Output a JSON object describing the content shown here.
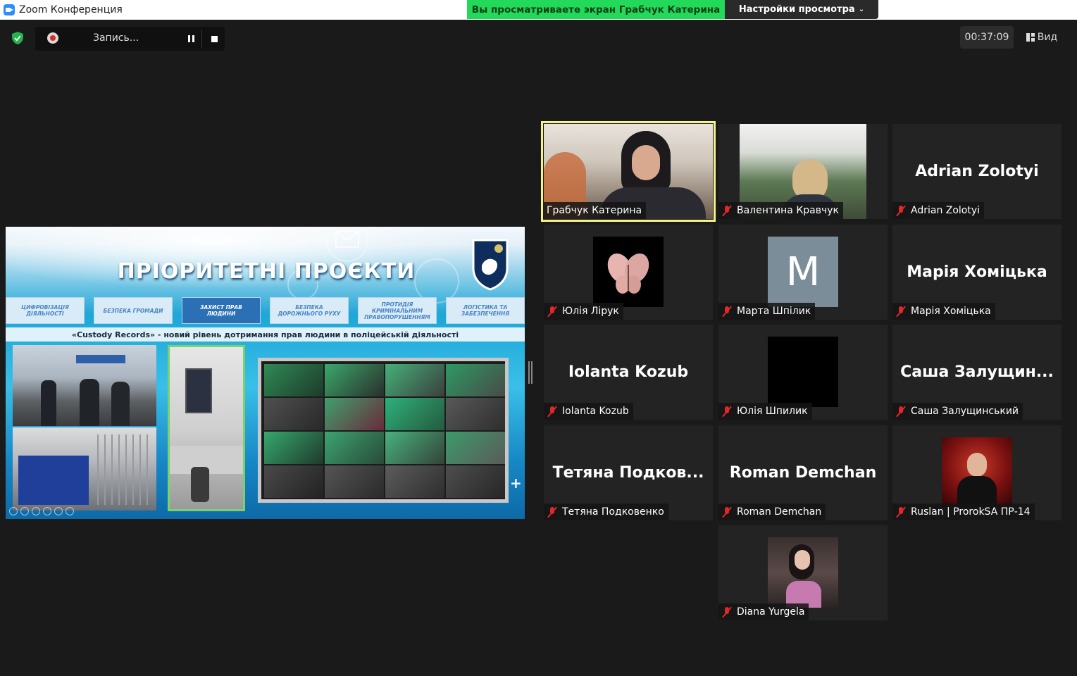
{
  "window": {
    "title": "Zoom Конференция"
  },
  "share_banner": {
    "text": "Вы просматриваете экран Грабчук Катерина",
    "view_options_label": "Настройки просмотра"
  },
  "recording": {
    "label": "Запись..."
  },
  "timer": {
    "value": "00:37:09"
  },
  "view_button": {
    "label": "Вид"
  },
  "slide": {
    "title": "ПРІОРИТЕТНІ ПРОЄКТИ",
    "tabs": [
      "ЦИФРОВІЗАЦІЯ ДІЯЛЬНОСТІ",
      "БЕЗПЕКА ГРОМАДИ",
      "ЗАХИСТ ПРАВ ЛЮДИНИ",
      "БЕЗПЕКА ДОРОЖНЬОГО РУХУ",
      "ПРОТИДІЯ КРИМІНАЛЬНИМ ПРАВОПОРУШЕННЯМ",
      "ЛОГІСТИКА ТА ЗАБЕЗПЕЧЕННЯ"
    ],
    "active_tab_index": 2,
    "subtitle": "«Custody Records» - новий рівень дотримання прав людини в поліцейській діяльності"
  },
  "participants": [
    {
      "name": "Грабчук Катерина",
      "display": "",
      "type": "video",
      "muted": false,
      "active": true
    },
    {
      "name": "Валентина Кравчук",
      "display": "",
      "type": "video",
      "muted": true
    },
    {
      "name": "Adrian Zolotyi",
      "display": "Adrian Zolotyi",
      "type": "name",
      "muted": true
    },
    {
      "name": "Юлія Лірук",
      "display": "",
      "type": "avatar-butterfly",
      "muted": true
    },
    {
      "name": "Марта Шпілик",
      "display": "M",
      "type": "avatar-letter",
      "muted": true
    },
    {
      "name": "Марія Хоміцька",
      "display": "Марія Хоміцька",
      "type": "name",
      "muted": true
    },
    {
      "name": "Iolanta Kozub",
      "display": "Iolanta Kozub",
      "type": "name",
      "muted": true
    },
    {
      "name": "Юлія Шпилик",
      "display": "",
      "type": "avatar-black",
      "muted": true
    },
    {
      "name": "Саша Залущинський",
      "display": "Саша  Залущин...",
      "type": "name",
      "muted": true
    },
    {
      "name": "Тетяна Подковенко",
      "display": "Тетяна  Подков...",
      "type": "name",
      "muted": true
    },
    {
      "name": "Roman Demchan",
      "display": "Roman Demchan",
      "type": "name",
      "muted": true
    },
    {
      "name": "Ruslan | ProrokSA ПР-14",
      "display": "",
      "type": "avatar-photo",
      "muted": true
    },
    {
      "name": "Diana Yurgela",
      "display": "",
      "type": "avatar-photo2",
      "muted": true
    }
  ],
  "colors": {
    "share_banner": "#23d959",
    "active_speaker": "#f4f38a",
    "muted_mic": "#e02828",
    "background": "#1a1a1a"
  },
  "icons": [
    "zoom-icon",
    "shield-check-icon",
    "record-icon",
    "pause-icon",
    "stop-icon",
    "gallery-view-icon",
    "mic-muted-icon"
  ]
}
